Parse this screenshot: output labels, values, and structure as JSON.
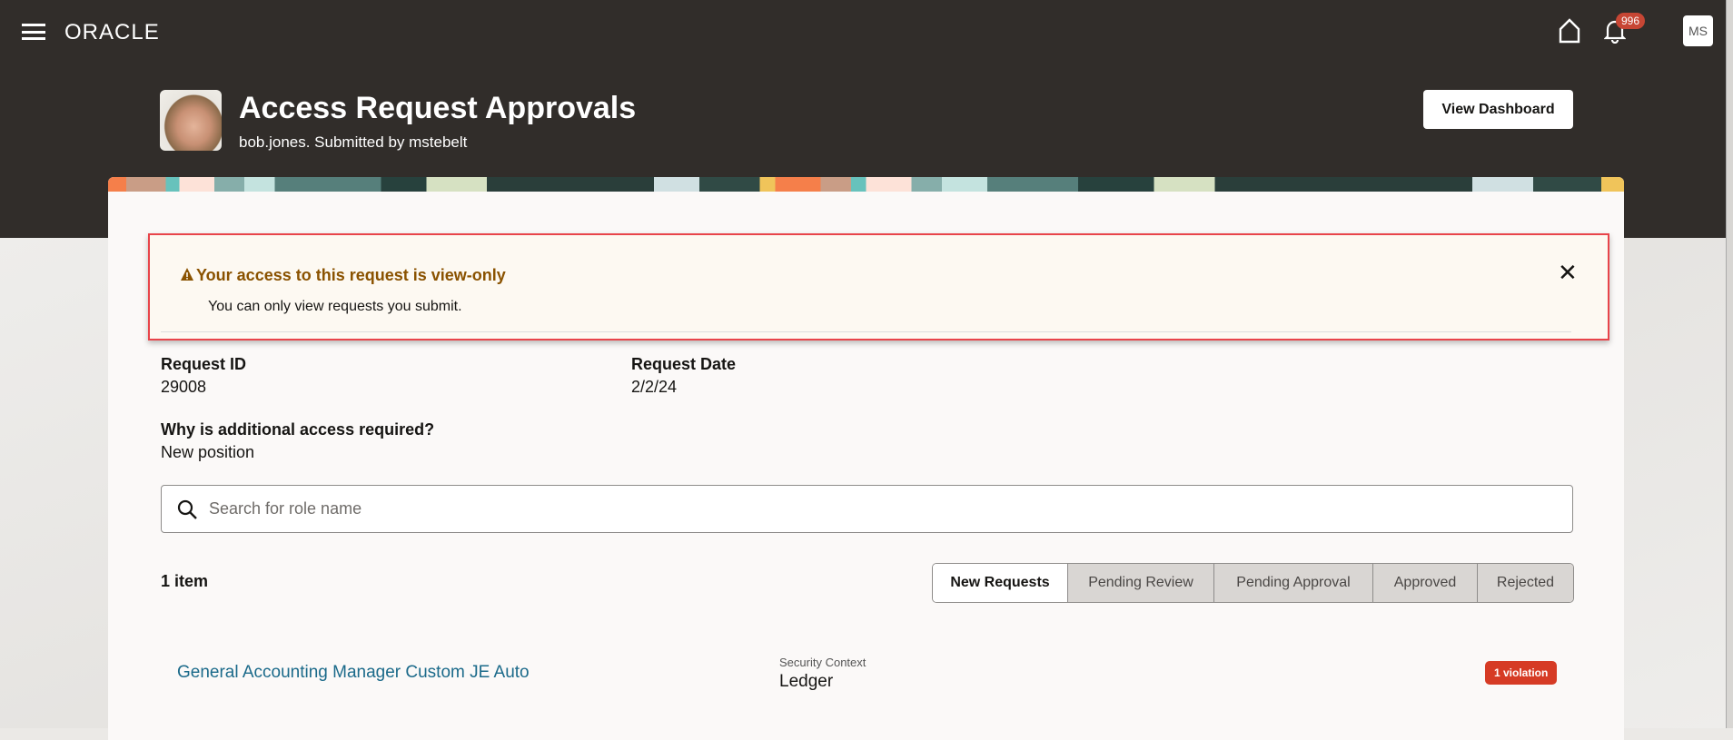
{
  "topbar": {
    "logo": "ORACLE",
    "notifications_count": "996",
    "user_initials": "MS"
  },
  "header": {
    "title": "Access Request Approvals",
    "subtitle": "bob.jones. Submitted by mstebelt",
    "view_dashboard": "View Dashboard"
  },
  "alert": {
    "title": "Your access to this request is view-only",
    "message": "You can only view requests you submit.",
    "close": "✕"
  },
  "details": {
    "request_id_label": "Request ID",
    "request_id": "29008",
    "request_date_label": "Request Date",
    "request_date": "2/2/24",
    "why_label": "Why is additional access required?",
    "why_value": "New position"
  },
  "search": {
    "placeholder": "Search for role name"
  },
  "list": {
    "count": "1 item",
    "tabs": [
      {
        "label": "New Requests"
      },
      {
        "label": "Pending Review"
      },
      {
        "label": "Pending Approval"
      },
      {
        "label": "Approved"
      },
      {
        "label": "Rejected"
      }
    ],
    "items": [
      {
        "role": "General Accounting Manager Custom JE Auto",
        "context_label": "Security Context",
        "context_value": "Ledger",
        "violations": "1 violation"
      }
    ]
  },
  "colors": {
    "header": "#312d2a",
    "link": "#1b6a8a",
    "violation": "#d63b25",
    "warning": "#8a5200"
  }
}
